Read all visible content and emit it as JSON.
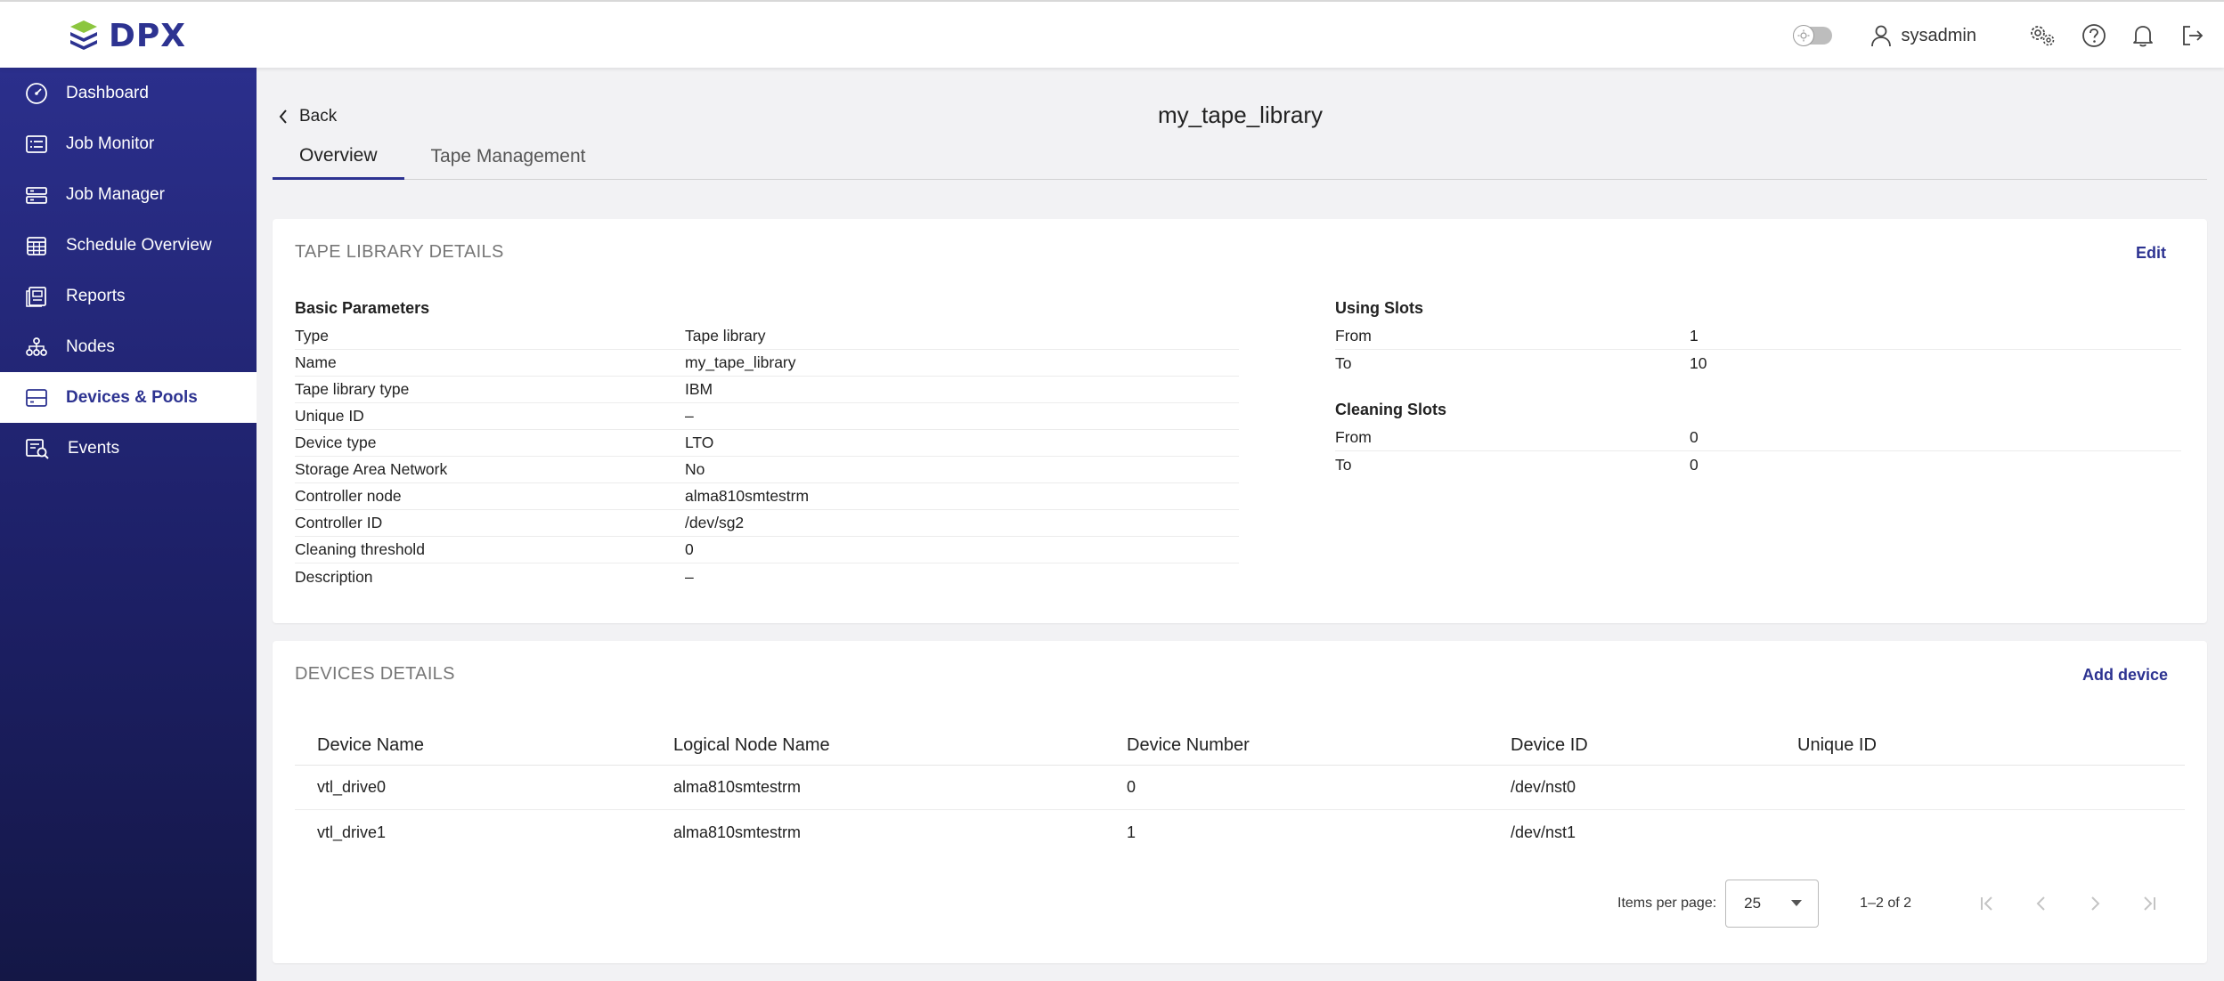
{
  "app": {
    "logo_text": "DPX"
  },
  "topbar": {
    "username": "sysadmin"
  },
  "sidebar": {
    "items": [
      {
        "label": "Dashboard",
        "icon": "dashboard-icon"
      },
      {
        "label": "Job Monitor",
        "icon": "job-monitor-icon"
      },
      {
        "label": "Job Manager",
        "icon": "job-manager-icon"
      },
      {
        "label": "Schedule Overview",
        "icon": "calendar-icon"
      },
      {
        "label": "Reports",
        "icon": "reports-icon"
      },
      {
        "label": "Nodes",
        "icon": "nodes-icon"
      },
      {
        "label": "Devices & Pools",
        "icon": "devices-icon",
        "active": true
      },
      {
        "label": "Events",
        "icon": "events-icon"
      }
    ]
  },
  "header": {
    "back_label": "Back",
    "title": "my_tape_library"
  },
  "tabs": [
    {
      "label": "Overview",
      "active": true
    },
    {
      "label": "Tape Management",
      "active": false
    }
  ],
  "details": {
    "title": "TAPE LIBRARY DETAILS",
    "edit_label": "Edit",
    "basic": {
      "heading": "Basic Parameters",
      "rows": [
        {
          "key": "Type",
          "value": "Tape library"
        },
        {
          "key": "Name",
          "value": "my_tape_library"
        },
        {
          "key": "Tape library type",
          "value": "IBM"
        },
        {
          "key": "Unique ID",
          "value": "–"
        },
        {
          "key": "Device type",
          "value": "LTO"
        },
        {
          "key": "Storage Area Network",
          "value": "No"
        },
        {
          "key": "Controller node",
          "value": "alma810smtestrm"
        },
        {
          "key": "Controller ID",
          "value": "/dev/sg2"
        },
        {
          "key": "Cleaning threshold",
          "value": "0"
        },
        {
          "key": "Description",
          "value": "–"
        }
      ]
    },
    "using_slots": {
      "heading": "Using Slots",
      "rows": [
        {
          "key": "From",
          "value": "1"
        },
        {
          "key": "To",
          "value": "10"
        }
      ]
    },
    "cleaning_slots": {
      "heading": "Cleaning Slots",
      "rows": [
        {
          "key": "From",
          "value": "0"
        },
        {
          "key": "To",
          "value": "0"
        }
      ]
    }
  },
  "devices": {
    "title": "DEVICES DETAILS",
    "add_label": "Add device",
    "columns": [
      "Device Name",
      "Logical Node Name",
      "Device Number",
      "Device ID",
      "Unique ID"
    ],
    "rows": [
      [
        "vtl_drive0",
        "alma810smtestrm",
        "0",
        "/dev/nst0",
        ""
      ],
      [
        "vtl_drive1",
        "alma810smtestrm",
        "1",
        "/dev/nst1",
        ""
      ]
    ],
    "pagination": {
      "items_per_page_label": "Items per page:",
      "items_per_page": "25",
      "range": "1–2 of 2"
    }
  },
  "colors": {
    "accent": "#2d3391",
    "sidebar_top": "#2b2f8c",
    "sidebar_bottom": "#141746"
  }
}
